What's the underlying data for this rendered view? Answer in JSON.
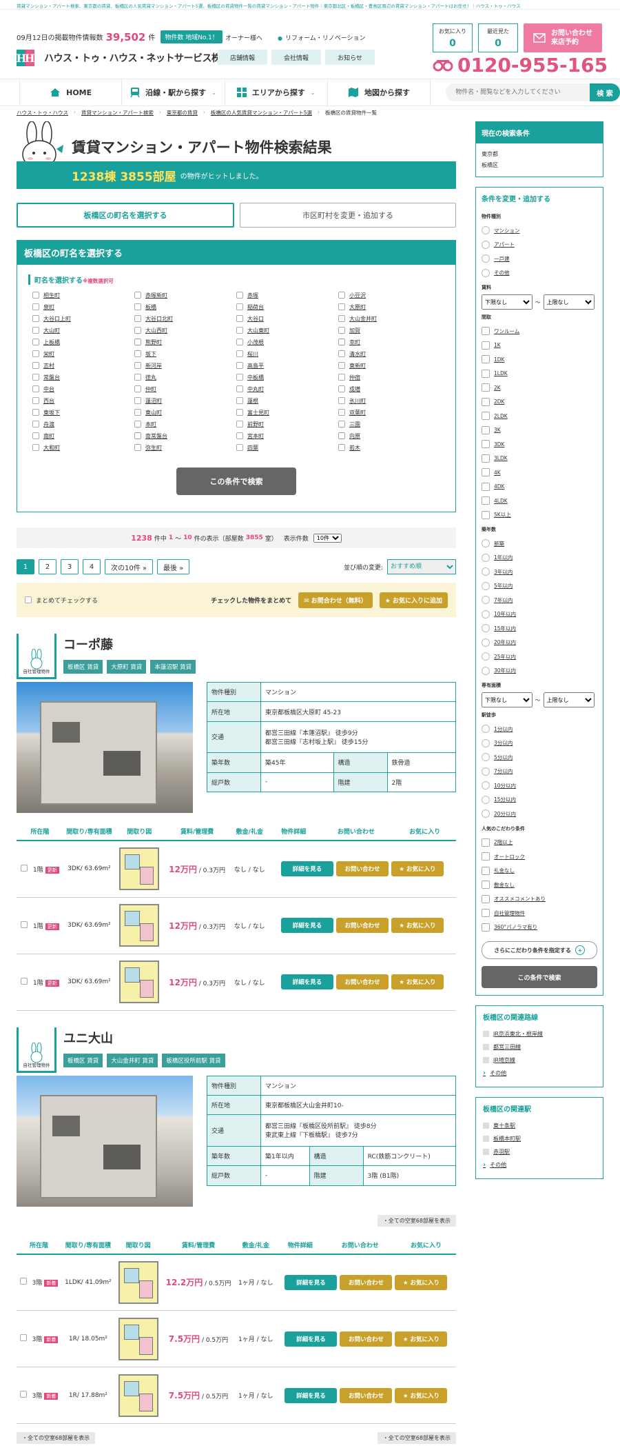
{
  "topbar": "賃貸マンション・アパート検索、東京都の賃貸、板橋区の人気賃貸マンション・アパート5選、板橋区の賃貸物件一覧の賃貸マンション・アパート物件｜東京都北区・板橋区・豊島区周辺の賃貸マンション・アパートはお任せ！｜ハウス・トゥ・ハウス",
  "header": {
    "date_prefix": "09月12日の掲載物件情報数",
    "count": "39,502",
    "unit": "件",
    "no1": "物件数 地域No.1！",
    "logo_mark": "H",
    "logo_text": "ハウス・トゥ・ハウス・ネットサービス株式会社",
    "link_owner": "オーナー様へ",
    "link_reform": "リフォーム・リノベーション",
    "btn_store": "店舗情報",
    "btn_company": "会社情報",
    "btn_news": "お知らせ",
    "fav_label": "お気に入り",
    "fav_count": "0",
    "recent_label": "最近見た",
    "recent_count": "0",
    "contact1": "お問い合わせ",
    "contact2": "来店予約",
    "phone": "0120-955-165"
  },
  "nav": {
    "home": "HOME",
    "line": "沿線・駅から探す",
    "area": "エリアから探す",
    "map": "地図から探す",
    "search_placeholder": "物件名・閲覧などを入力してください",
    "search_btn": "検 索"
  },
  "breadcrumb": [
    "ハウス・トゥ・ハウス",
    "賃貸マンション・アパート検索",
    "東京都の賃貸",
    "板橋区の人気賃貸マンション・アパート5選",
    "板橋区の賃貸物件一覧"
  ],
  "title": "賃貸マンション・アパート物件検索結果",
  "result": {
    "buildings": "1238棟",
    "rooms": "3855部屋",
    "suffix": "の物件がヒットしました。"
  },
  "tabs": {
    "active": "板橋区の町名を選択する",
    "other": "市区町村を変更・追加する"
  },
  "town_box": {
    "head": "板橋区の町名を選択する",
    "sub": "町名を選択する",
    "note": "※複数選択可",
    "search": "この条件で検索",
    "towns": [
      "相生町",
      "赤塚新町",
      "赤塚",
      "小豆沢",
      "泉町",
      "板橋",
      "稲荷台",
      "大原町",
      "大谷口上町",
      "大谷口北町",
      "大谷口",
      "大山金井町",
      "大山町",
      "大山西町",
      "大山東町",
      "加賀",
      "上板橋",
      "熊野町",
      "小茂根",
      "幸町",
      "栄町",
      "坂下",
      "桜川",
      "清水町",
      "志村",
      "新河岸",
      "高島平",
      "東新町",
      "常盤台",
      "徳丸",
      "中板橋",
      "仲宿",
      "中台",
      "仲町",
      "中丸町",
      "成増",
      "西台",
      "蓮沼町",
      "蓮根",
      "氷川町",
      "東坂下",
      "東山町",
      "富士見町",
      "双葉町",
      "舟渡",
      "本町",
      "前野町",
      "三園",
      "南町",
      "南常盤台",
      "宮本町",
      "向原",
      "大和町",
      "弥生町",
      "四葉",
      "若木"
    ]
  },
  "count_bar": {
    "total": "1238",
    "mid": "件中",
    "range_a": "1",
    "tilde": "〜",
    "range_b": "10",
    "tail": "件の表示（部屋数",
    "rooms": "3855",
    "tail2": "室）",
    "per": "表示件数",
    "per_val": "10件"
  },
  "pager": {
    "pages": [
      "1",
      "2",
      "3",
      "4"
    ],
    "next": "次の10件 »",
    "last": "最後 »",
    "sort_label": "並び順の変更:",
    "sort_val": "おすすめ順"
  },
  "bulk": {
    "check_all": "まとめてチェックする",
    "text": "チェックした物件をまとめて",
    "contact": "お問合わせ（無料）",
    "fav": "お気に入りに追加"
  },
  "table_headers": [
    "所在階",
    "間取り/専有面積",
    "間取り図",
    "賃料/管理費",
    "敷金/礼金",
    "物件詳細",
    "お問い合わせ",
    "お気に入り"
  ],
  "labels": {
    "self": "自社管理物件",
    "detail": "詳細を見る",
    "inquiry": "お問い合わせ",
    "fav": "★ お気に入り",
    "new": "新着",
    "update": "更新",
    "rent_unit": "万円",
    "all_rooms": "・全ての空室68部屋を表示"
  },
  "props": [
    {
      "name": "コーポ藤",
      "tags": [
        "板橋区 賃貸",
        "大原町 賃貸",
        "本蓮沼駅 賃貸"
      ],
      "type_h": "物件種別",
      "type": "マンション",
      "addr_h": "所在地",
      "addr": "東京都板橋区大原町 45-23",
      "traffic_h": "交通",
      "traffic1": "都営三田線『本蓮沼駅』 徒歩9分",
      "traffic2": "都営三田線『志村坂上駅』 徒歩15分",
      "age_h": "築年数",
      "age": "築45年",
      "struct_h": "構造",
      "struct": "鉄骨造",
      "units_h": "総戸数",
      "units": "-",
      "floors_h": "階建",
      "floors": "2階",
      "rooms": [
        {
          "floor": "1階",
          "tag": "更新",
          "plan": "3DK/ 63.69m²",
          "rent": "12万円",
          "fee": "/ 0.3万円",
          "deposit": "なし / なし"
        },
        {
          "floor": "1階",
          "tag": "更新",
          "plan": "3DK/ 63.69m²",
          "rent": "12万円",
          "fee": "/ 0.3万円",
          "deposit": "なし / なし"
        },
        {
          "floor": "1階",
          "tag": "更新",
          "plan": "3DK/ 63.69m²",
          "rent": "12万円",
          "fee": "/ 0.3万円",
          "deposit": "なし / なし"
        }
      ]
    },
    {
      "name": "ユニ大山",
      "tags": [
        "板橋区 賃貸",
        "大山金井町 賃貸",
        "板橋区役所前駅 賃貸"
      ],
      "type_h": "物件種別",
      "type": "マンション",
      "addr_h": "所在地",
      "addr": "東京都板橋区大山金井町10-",
      "traffic_h": "交通",
      "traffic1": "都営三田線『板橋区役所前駅』 徒歩8分",
      "traffic2": "東武東上線『下板橋駅』 徒歩7分",
      "age_h": "築年数",
      "age": "築1年以内",
      "struct_h": "構造",
      "struct": "RC(鉄筋コンクリート)",
      "units_h": "総戸数",
      "units": "-",
      "floors_h": "階建",
      "floors": "3階 (B1階)",
      "rooms": [
        {
          "floor": "3階",
          "tag": "新着",
          "plan": "1LDK/ 41.09m²",
          "rent": "12.2万円",
          "fee": "/ 0.5万円",
          "deposit": "1ヶ月 / なし"
        },
        {
          "floor": "3階",
          "tag": "新着",
          "plan": "1R/ 18.05m²",
          "rent": "7.5万円",
          "fee": "/ 0.5万円",
          "deposit": "1ヶ月 / なし"
        },
        {
          "floor": "3階",
          "tag": "新着",
          "plan": "1R/ 17.88m²",
          "rent": "7.5万円",
          "fee": "/ 0.5万円",
          "deposit": "1ヶ月 / なし"
        }
      ]
    }
  ],
  "side": {
    "cond_head": "現在の検索条件",
    "cond1": "東京都",
    "cond2": "板橋区",
    "change_title": "条件を変更・追加する",
    "type_h": "物件種別",
    "types": [
      "マンション",
      "アパート",
      "一戸建",
      "その他"
    ],
    "rent_h": "賃料",
    "rent_min": "下限なし",
    "rent_max": "上限なし",
    "tilde": "〜",
    "layout_h": "間取",
    "layouts": [
      "ワンルーム",
      "1K",
      "1DK",
      "1LDK",
      "2K",
      "2DK",
      "2LDK",
      "3K",
      "3DK",
      "3LDK",
      "4K",
      "4DK",
      "4LDK",
      "5K以上"
    ],
    "age_h": "築年数",
    "ages": [
      "新築",
      "1年以内",
      "3年以内",
      "5年以内",
      "7年以内",
      "10年以内",
      "15年以内",
      "20年以内",
      "25年以内",
      "30年以内"
    ],
    "area_h": "専有面積",
    "area_min": "下限なし",
    "area_max": "上限なし",
    "walk_h": "駅徒歩",
    "walks": [
      "1分以内",
      "3分以内",
      "5分以内",
      "7分以内",
      "10分以内",
      "15分以内",
      "20分以内"
    ],
    "pop_h": "人気のこだわり条件",
    "pops": [
      "2階以上",
      "オートロック",
      "礼金なし",
      "敷金なし",
      "オススメコメントあり",
      "自社管理物件",
      "360°パノラマ有り"
    ],
    "more": "さらにこだわり条件を指定する",
    "search": "この条件で検索",
    "lines_head": "板橋区の関連路線",
    "lines": [
      "JR京浜東北・根岸線",
      "都営三田線",
      "JR埼京線"
    ],
    "more_link": "その他",
    "st_head": "板橋区の関連駅",
    "stations": [
      "東十条駅",
      "板橋本町駅",
      "赤羽駅"
    ]
  },
  "colors": {
    "accent": "#1aa19b",
    "pink": "#e04a7a",
    "gold": "#c9a12a"
  }
}
